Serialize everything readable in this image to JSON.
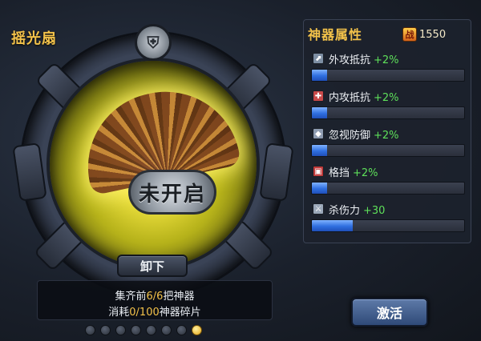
{
  "item": {
    "name": "摇光扇",
    "lock_text": "未开启",
    "unequip_label": "卸下",
    "collect": {
      "line1_prefix": "集齐前",
      "line1_value": "6/6",
      "line1_suffix": "把神器",
      "line2_prefix": "消耗",
      "line2_value": "0/100",
      "line2_suffix": "神器碎片"
    },
    "pager": {
      "total": 8,
      "active_index": 7
    }
  },
  "attributes": {
    "title": "神器属性",
    "power_value": "1550",
    "power_icon_text": "战",
    "rows": [
      {
        "label": "外攻抵抗",
        "bonus": "+2%",
        "icon": "shield-arrow-icon",
        "icon_color": "#7d8ea3",
        "fill_fraction": 0.1
      },
      {
        "label": "内攻抵抗",
        "bonus": "+2%",
        "icon": "red-cross-icon",
        "icon_color": "#c84a4a",
        "fill_fraction": 0.1
      },
      {
        "label": "忽视防御",
        "bonus": "+2%",
        "icon": "shield-icon",
        "icon_color": "#8d9bb0",
        "fill_fraction": 0.1
      },
      {
        "label": "格挡",
        "bonus": "+2%",
        "icon": "red-shield-icon",
        "icon_color": "#c03a3a",
        "fill_fraction": 0.1
      },
      {
        "label": "杀伤力",
        "bonus": "+30",
        "icon": "sword-icon",
        "icon_color": "#9aa7b8",
        "fill_fraction": 0.27
      }
    ]
  },
  "activate_label": "激活",
  "colors": {
    "accent_gold": "#f3c24a",
    "bonus_green": "#5ee05a",
    "bar_blue": "#2f6fe0"
  }
}
